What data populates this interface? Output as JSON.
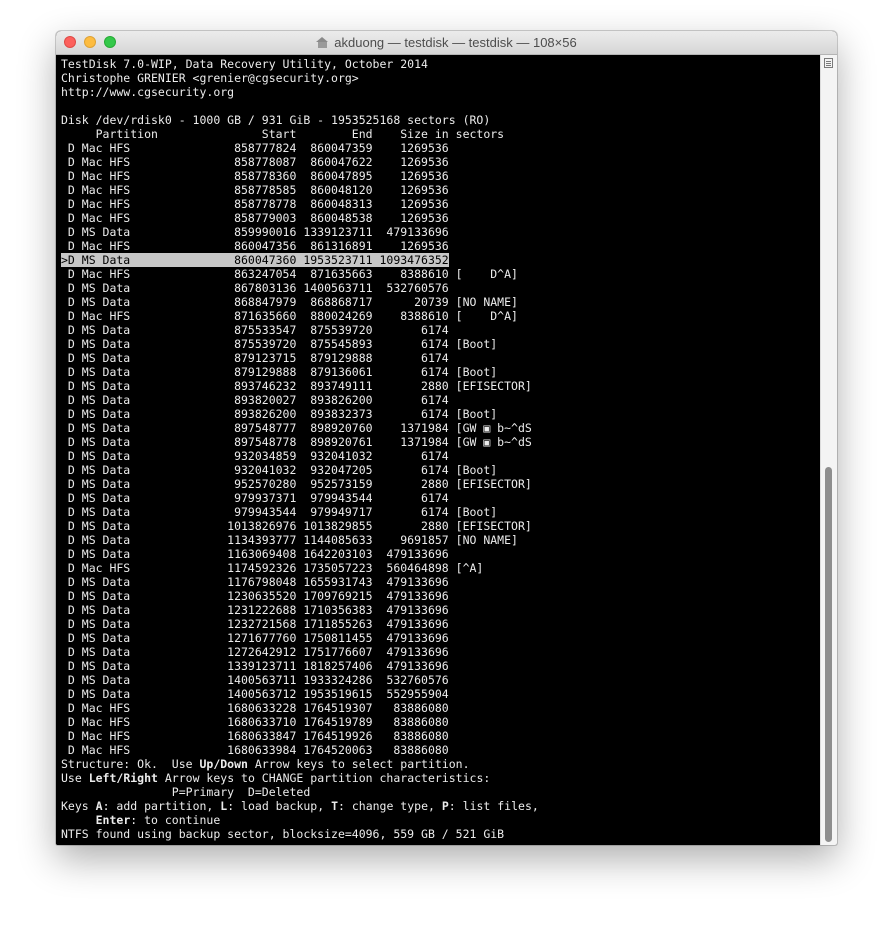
{
  "window": {
    "title": "akduong — testdisk — testdisk — 108×56"
  },
  "terminal": {
    "header": [
      "TestDisk 7.0-WIP, Data Recovery Utility, October 2014",
      "Christophe GRENIER <grenier@cgsecurity.org>",
      "http://www.cgsecurity.org",
      "",
      "Disk /dev/rdisk0 - 1000 GB / 931 GiB - 1953525168 sectors (RO)",
      "     Partition               Start        End    Size in sectors"
    ],
    "selected_index": 8,
    "partitions": [
      " D Mac HFS               858777824  860047359    1269536",
      " D Mac HFS               858778087  860047622    1269536",
      " D Mac HFS               858778360  860047895    1269536",
      " D Mac HFS               858778585  860048120    1269536",
      " D Mac HFS               858778778  860048313    1269536",
      " D Mac HFS               858779003  860048538    1269536",
      " D MS Data               859990016 1339123711  479133696",
      " D Mac HFS               860047356  861316891    1269536",
      ">D MS Data               860047360 1953523711 1093476352",
      " D Mac HFS               863247054  871635663    8388610 [    D^A]",
      " D MS Data               867803136 1400563711  532760576",
      " D MS Data               868847979  868868717      20739 [NO NAME]",
      " D Mac HFS               871635660  880024269    8388610 [    D^A]",
      " D MS Data               875533547  875539720       6174",
      " D MS Data               875539720  875545893       6174 [Boot]",
      " D MS Data               879123715  879129888       6174",
      " D MS Data               879129888  879136061       6174 [Boot]",
      " D MS Data               893746232  893749111       2880 [EFISECTOR]",
      " D MS Data               893820027  893826200       6174",
      " D MS Data               893826200  893832373       6174 [Boot]",
      " D MS Data               897548777  898920760    1371984 [GW ▣ b~^dS",
      " D MS Data               897548778  898920761    1371984 [GW ▣ b~^dS",
      " D MS Data               932034859  932041032       6174",
      " D MS Data               932041032  932047205       6174 [Boot]",
      " D MS Data               952570280  952573159       2880 [EFISECTOR]",
      " D MS Data               979937371  979943544       6174",
      " D MS Data               979943544  979949717       6174 [Boot]",
      " D MS Data              1013826976 1013829855       2880 [EFISECTOR]",
      " D MS Data              1134393777 1144085633    9691857 [NO NAME]",
      " D MS Data              1163069408 1642203103  479133696",
      " D Mac HFS              1174592326 1735057223  560464898 [^A]",
      " D MS Data              1176798048 1655931743  479133696",
      " D MS Data              1230635520 1709769215  479133696",
      " D MS Data              1231222688 1710356383  479133696",
      " D MS Data              1232721568 1711855263  479133696",
      " D MS Data              1271677760 1750811455  479133696",
      " D MS Data              1272642912 1751776607  479133696",
      " D MS Data              1339123711 1818257406  479133696",
      " D MS Data              1400563711 1933324286  532760576",
      " D MS Data              1400563712 1953519615  552955904",
      " D Mac HFS              1680633228 1764519307   83886080",
      " D Mac HFS              1680633710 1764519789   83886080",
      " D Mac HFS              1680633847 1764519926   83886080",
      " D Mac HFS              1680633984 1764520063   83886080"
    ],
    "footer": {
      "structure": {
        "prefix": "Structure: Ok.  Use ",
        "key": "Up/Down",
        "suffix": " Arrow keys to select partition."
      },
      "change": {
        "prefix": "Use ",
        "key": "Left/Right",
        "suffix": " Arrow keys to CHANGE partition characteristics:"
      },
      "legend": "                P=Primary  D=Deleted",
      "keys": {
        "p1": "Keys ",
        "k1": "A",
        "p2": ": add partition, ",
        "k2": "L",
        "p3": ": load backup, ",
        "k3": "T",
        "p4": ": change type, ",
        "k4": "P",
        "p5": ": list files,"
      },
      "enter": {
        "indent": "     ",
        "key": "Enter",
        "suffix": ": to continue"
      },
      "status": "NTFS found using backup sector, blocksize=4096, 559 GB / 521 GiB"
    }
  }
}
